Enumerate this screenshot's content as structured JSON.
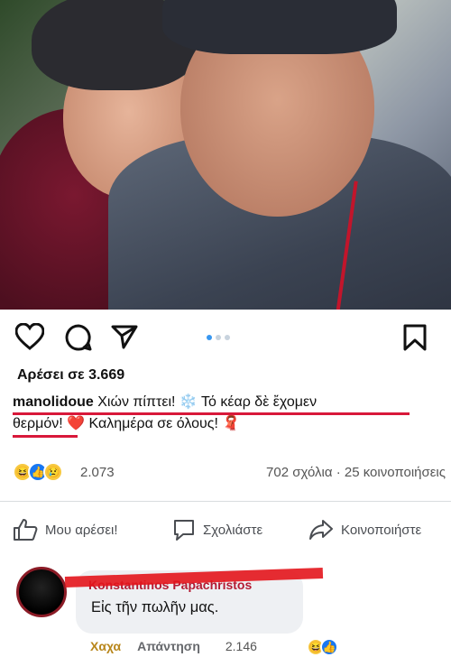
{
  "instagram": {
    "likes_text": "Αρέσει σε 3.669",
    "caption_user": "manolidoue",
    "caption_text_1": " Χιών πίπτει! ",
    "caption_emoji_1": "❄️",
    "caption_text_2": " Τό κέαρ δὲ ἔχομεν",
    "caption_text_3": "θερμόν!",
    "caption_heart": "❤️",
    "caption_text_4": " Καλημέρα σε όλους! ",
    "caption_emoji_2": "🧣",
    "icons": [
      "heart-icon",
      "comment-icon",
      "share-icon",
      "bookmark-icon"
    ]
  },
  "facebook": {
    "reaction_count": "2.073",
    "comments_shares": "702 σχόλια · 25 κοινοποιήσεις",
    "reactions": [
      "haha",
      "like",
      "sad"
    ],
    "actions": {
      "like": "Μου αρέσει!",
      "comment": "Σχολιάστε",
      "share": "Κοινοποιήστε"
    }
  },
  "comment": {
    "author": "Konstantinos Papachristos",
    "text": "Εἰς τῆν πωλῆν μας.",
    "haha": "Χαχα",
    "reply": "Απάντηση",
    "count": "2.146"
  },
  "colors": {
    "accent_red": "#d8183a",
    "fb_blue": "#1877f2",
    "ig_blue": "#3897f0"
  }
}
